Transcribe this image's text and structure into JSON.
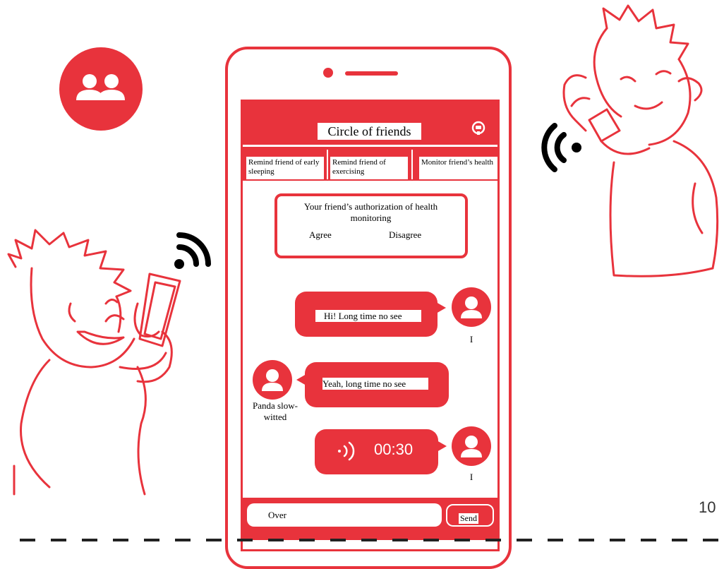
{
  "header": {
    "title": "Circle of friends"
  },
  "tabs": [
    {
      "label": "Remind friend of early sleeping"
    },
    {
      "label": "Remind friend of exercising"
    },
    {
      "label": "Monitor friend’s health"
    }
  ],
  "authorization": {
    "text": "Your friend’s authorization of health monitoring",
    "agree": "Agree",
    "disagree": "Disagree"
  },
  "messages": [
    {
      "text": "Hi! Long time no see",
      "sender": "I"
    },
    {
      "text": "Yeah, long time no see",
      "sender": "Panda slow-witted"
    },
    {
      "voice_duration": "00:30",
      "sender": "I"
    }
  ],
  "composer": {
    "input_value": "Over",
    "send_label": "Send"
  },
  "page_number": "10",
  "colors": {
    "accent": "#e8333c",
    "line_art": "#e8333c",
    "background": "#ffffff"
  }
}
